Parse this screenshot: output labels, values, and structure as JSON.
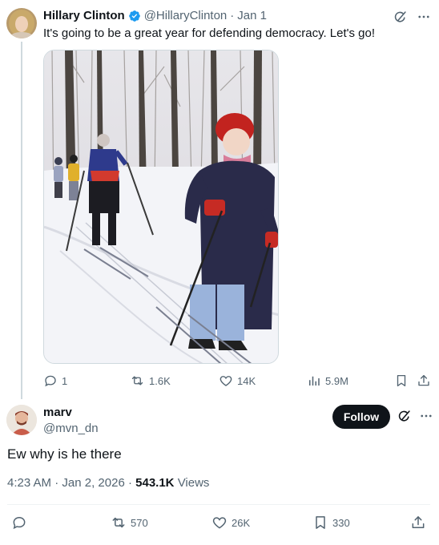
{
  "tweet": {
    "author_name": "Hillary Clinton",
    "handle": "@HillaryClinton",
    "separator": "·",
    "date": "Jan 1",
    "text": "It's going to be a great year for defending democracy. Let's go!",
    "stats": {
      "replies": "1",
      "reposts": "1.6K",
      "likes": "14K",
      "views": "5.9M"
    }
  },
  "reply": {
    "author_name": "marv",
    "handle": "@mvn_dn",
    "follow_label": "Follow",
    "text": "Ew why is he there",
    "time": "4:23 AM",
    "date": "Jan 2, 2026",
    "separator": "·",
    "views_count": "543.1K",
    "views_label": "Views",
    "stats": {
      "reposts": "570",
      "likes": "26K",
      "bookmarks": "330"
    }
  },
  "colors": {
    "text_primary": "#0f1419",
    "text_secondary": "#536471",
    "verified_blue": "#1d9bf0",
    "divider": "#eff3f4",
    "button_dark": "#0f1419"
  }
}
